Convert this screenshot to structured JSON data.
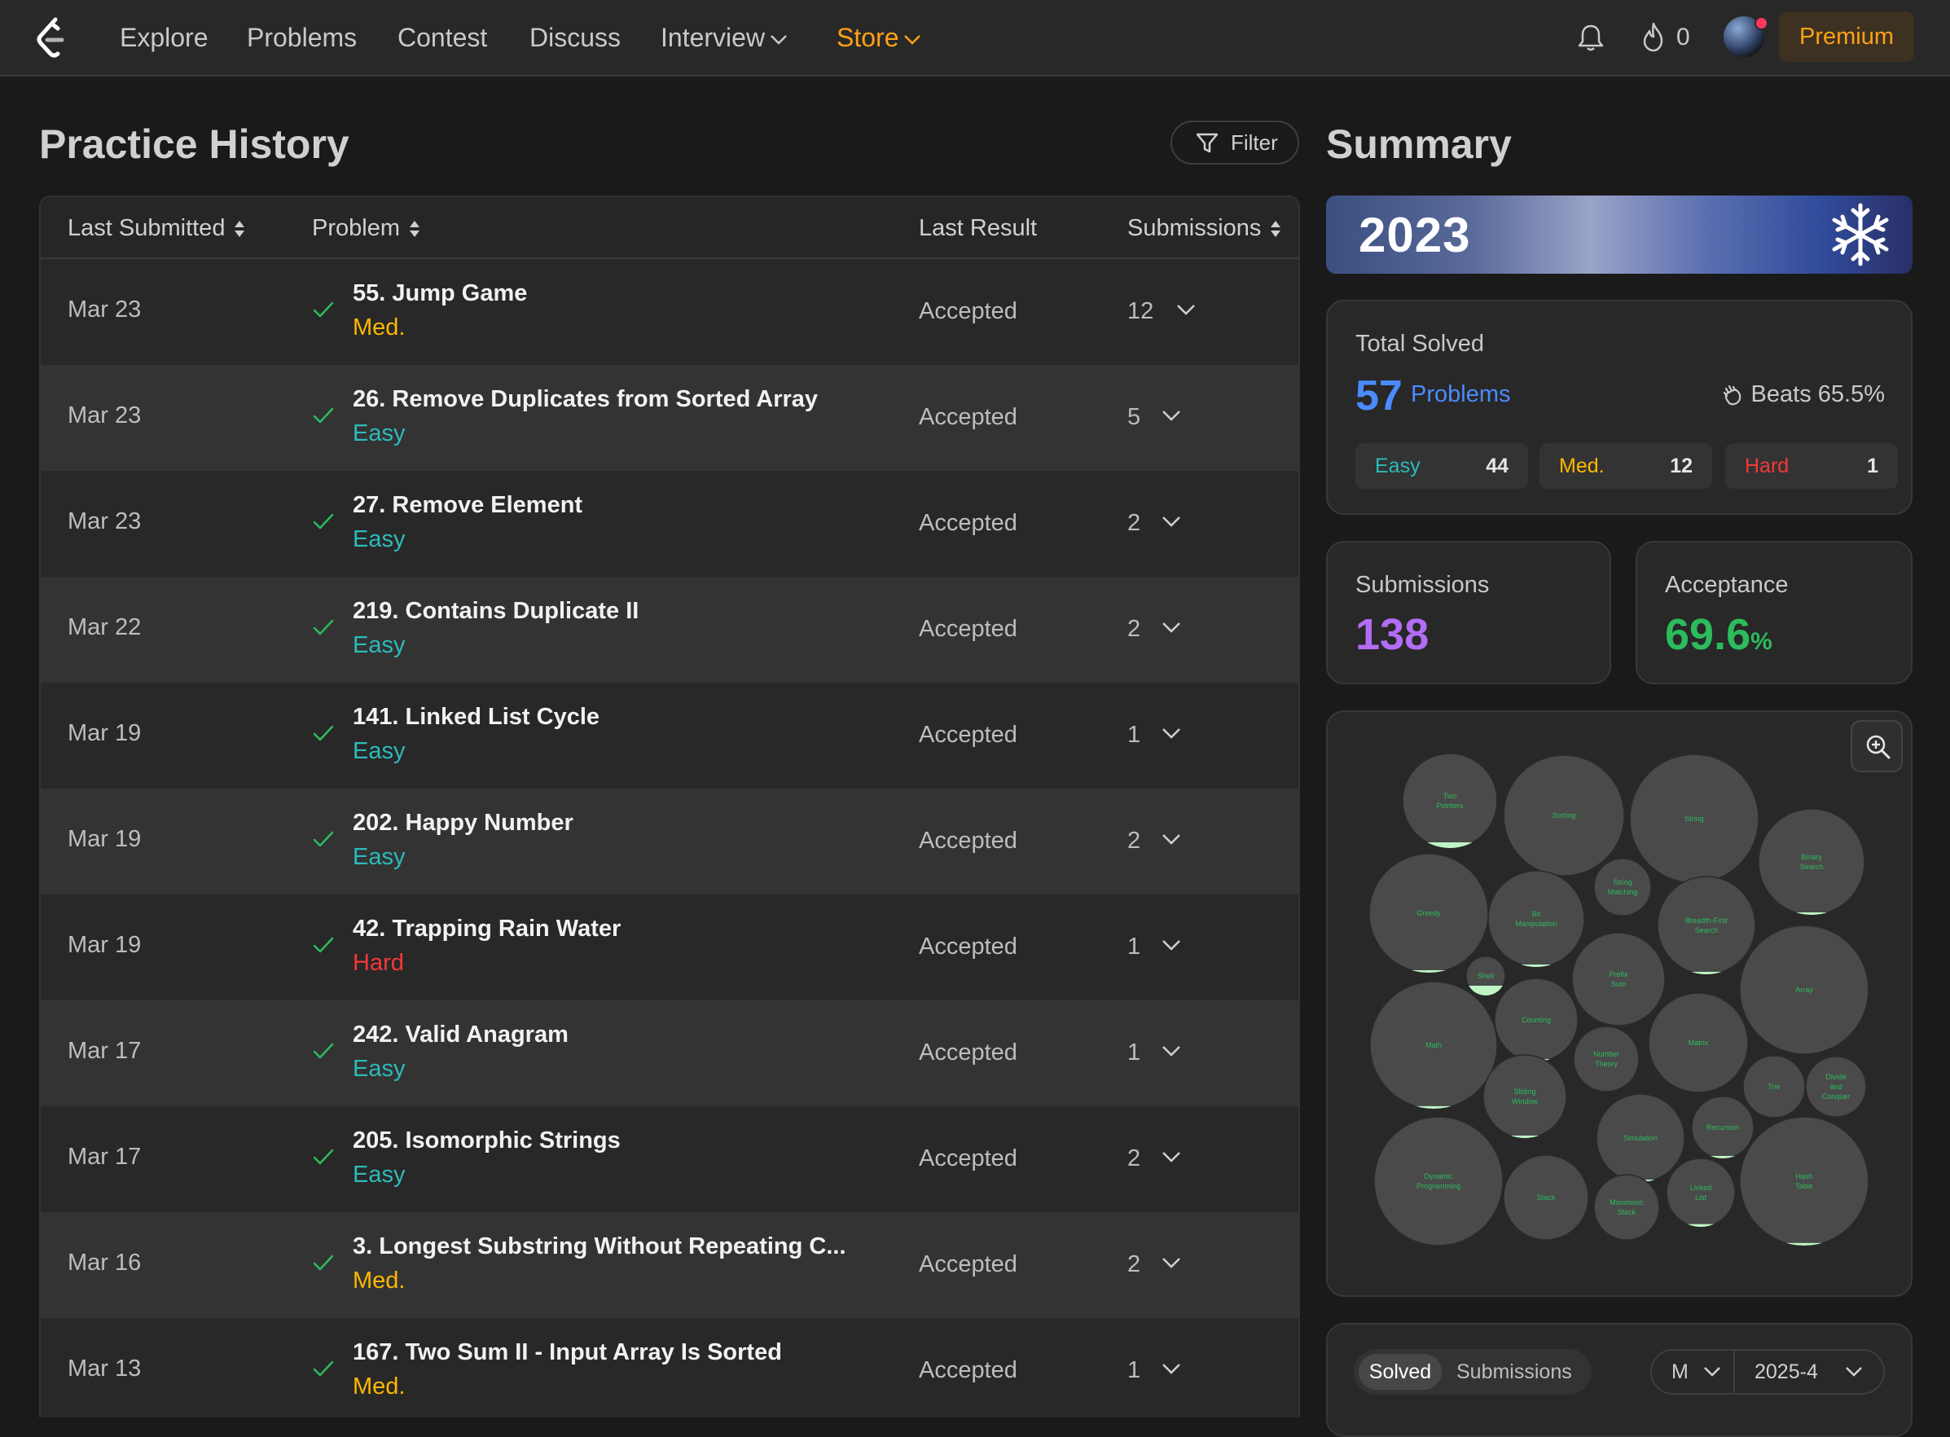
{
  "nav": {
    "links": [
      "Explore",
      "Problems",
      "Contest",
      "Discuss",
      "Interview",
      "Store"
    ],
    "streak_count": "0",
    "premium_label": "Premium",
    "colors": {
      "accent": "#ffa116"
    }
  },
  "history": {
    "title": "Practice History",
    "filter_label": "Filter",
    "headers": {
      "last_submitted": "Last Submitted",
      "problem": "Problem",
      "last_result": "Last Result",
      "submissions": "Submissions"
    },
    "rows": [
      {
        "date": "Mar 23",
        "title": "55. Jump Game",
        "difficulty": "Med.",
        "level": "med",
        "result": "Accepted",
        "submissions": "12"
      },
      {
        "date": "Mar 23",
        "title": "26. Remove Duplicates from Sorted Array",
        "difficulty": "Easy",
        "level": "easy",
        "result": "Accepted",
        "submissions": "5"
      },
      {
        "date": "Mar 23",
        "title": "27. Remove Element",
        "difficulty": "Easy",
        "level": "easy",
        "result": "Accepted",
        "submissions": "2"
      },
      {
        "date": "Mar 22",
        "title": "219. Contains Duplicate II",
        "difficulty": "Easy",
        "level": "easy",
        "result": "Accepted",
        "submissions": "2"
      },
      {
        "date": "Mar 19",
        "title": "141. Linked List Cycle",
        "difficulty": "Easy",
        "level": "easy",
        "result": "Accepted",
        "submissions": "1"
      },
      {
        "date": "Mar 19",
        "title": "202. Happy Number",
        "difficulty": "Easy",
        "level": "easy",
        "result": "Accepted",
        "submissions": "2"
      },
      {
        "date": "Mar 19",
        "title": "42. Trapping Rain Water",
        "difficulty": "Hard",
        "level": "hard",
        "result": "Accepted",
        "submissions": "1"
      },
      {
        "date": "Mar 17",
        "title": "242. Valid Anagram",
        "difficulty": "Easy",
        "level": "easy",
        "result": "Accepted",
        "submissions": "1"
      },
      {
        "date": "Mar 17",
        "title": "205. Isomorphic Strings",
        "difficulty": "Easy",
        "level": "easy",
        "result": "Accepted",
        "submissions": "2"
      },
      {
        "date": "Mar 16",
        "title": "3. Longest Substring Without Repeating C...",
        "difficulty": "Med.",
        "level": "med",
        "result": "Accepted",
        "submissions": "2"
      },
      {
        "date": "Mar 13",
        "title": "167. Two Sum II - Input Array Is Sorted",
        "difficulty": "Med.",
        "level": "med",
        "result": "Accepted",
        "submissions": "1"
      }
    ]
  },
  "summary": {
    "title": "Summary",
    "year": "2023",
    "total_solved_label": "Total Solved",
    "total_solved": "57",
    "problems_label": "Problems",
    "beats": "Beats 65.5%",
    "easy": {
      "label": "Easy",
      "count": "44"
    },
    "med": {
      "label": "Med.",
      "count": "12"
    },
    "hard": {
      "label": "Hard",
      "count": "1"
    },
    "submissions_label": "Submissions",
    "submissions": "138",
    "acceptance_label": "Acceptance",
    "acceptance": "69.6",
    "acceptance_unit": "%",
    "tabs": {
      "solved": "Solved",
      "submissions": "Submissions"
    },
    "mode_select": "M",
    "month_select": "2025-4",
    "colors": {
      "easy": "#2cbbba",
      "med": "#ffb800",
      "hard": "#f63737",
      "submissions": "#b26cf5",
      "acceptance": "#2cbb5d",
      "problems": "#4a8cff"
    }
  },
  "topics": [
    {
      "name": "Two Pointers",
      "fill": 0.06
    },
    {
      "name": "Sorting",
      "fill": 0
    },
    {
      "name": "String",
      "fill": 0
    },
    {
      "name": "Binary Search",
      "fill": 0.01
    },
    {
      "name": "Greedy",
      "fill": 0.01
    },
    {
      "name": "Bit Manipulation",
      "fill": 0.01
    },
    {
      "name": "String Matching",
      "fill": 0
    },
    {
      "name": "Breadth-First Search",
      "fill": 0.01
    },
    {
      "name": "Shell",
      "fill": 0.25
    },
    {
      "name": "Prefix Sum",
      "fill": 0
    },
    {
      "name": "Array",
      "fill": 0
    },
    {
      "name": "Math",
      "fill": 0.02
    },
    {
      "name": "Counting",
      "fill": 0.02
    },
    {
      "name": "Matrix",
      "fill": 0
    },
    {
      "name": "Number Theory",
      "fill": 0
    },
    {
      "name": "Trie",
      "fill": 0
    },
    {
      "name": "Divide and Conquer",
      "fill": 0
    },
    {
      "name": "Sliding Window",
      "fill": 0.01
    },
    {
      "name": "Simulation",
      "fill": 0.01
    },
    {
      "name": "Recursion",
      "fill": 0.01
    },
    {
      "name": "Dynamic Programming",
      "fill": 0
    },
    {
      "name": "Stack",
      "fill": 0
    },
    {
      "name": "Monotonic Stack",
      "fill": 0
    },
    {
      "name": "Linked List",
      "fill": 0.04
    },
    {
      "name": "Hash Table",
      "fill": 0.02
    }
  ]
}
